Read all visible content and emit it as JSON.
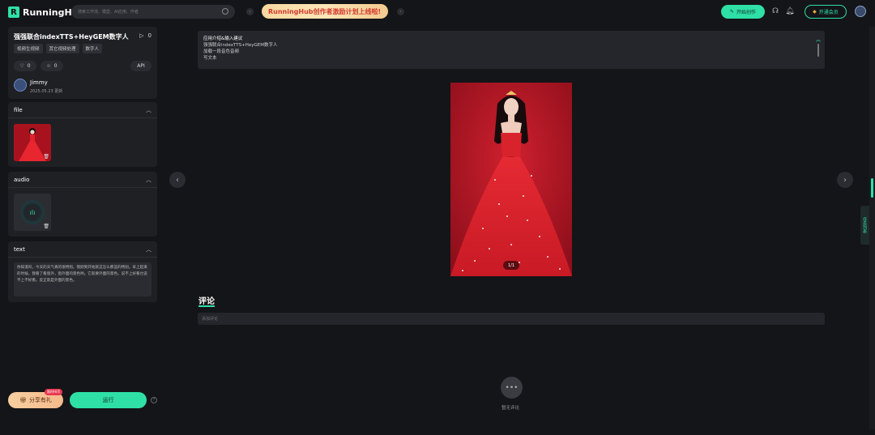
{
  "header": {
    "logo_mark": "R",
    "logo_text": "RunningHUB",
    "search_placeholder": "搜索工作流、模型、AI应用、作者",
    "banner_text": "RunningHub创作者激励计划上线啦!",
    "create_label": "开始创作",
    "member_label": "开通会员"
  },
  "app_info": {
    "title": "强强联合indexTTS+HeyGEM数字人",
    "play_count": "0",
    "tags": [
      "视频生视频",
      "其它视频处理",
      "数字人"
    ],
    "likes": "0",
    "favorites": "0",
    "api_label": "API",
    "author": "Jimmy",
    "updated": "2025.05.23 更新"
  },
  "sections": {
    "file_title": "file",
    "audio_title": "audio",
    "text_title": "text",
    "text_content": "你知道吗，今天的天气真的很特别。我刚到开始就这怎么那蓝的特别。早上起来的时候，我看了看窗外，窗外面的景色哟。它就要外面的景色。说不上好看也说不上不好看。反正就是外面的景色。"
  },
  "bottom": {
    "share_label": "分享有礼",
    "share_badge": "限时Hi币",
    "run_label": "运行"
  },
  "description": {
    "heading": "应用介绍&输入建议",
    "lines": [
      "强强联合indexTTS+HeyGEM数字人",
      "加载一段音色音频",
      "写文本"
    ]
  },
  "viewer": {
    "counter": "1/1"
  },
  "comments": {
    "title": "评论",
    "placeholder": "添加评论",
    "empty_text": "暂无评论"
  },
  "task_tab_label": "任务列表",
  "colors": {
    "accent": "#2fe0a6",
    "background": "#141518",
    "panel": "#1f2024"
  }
}
